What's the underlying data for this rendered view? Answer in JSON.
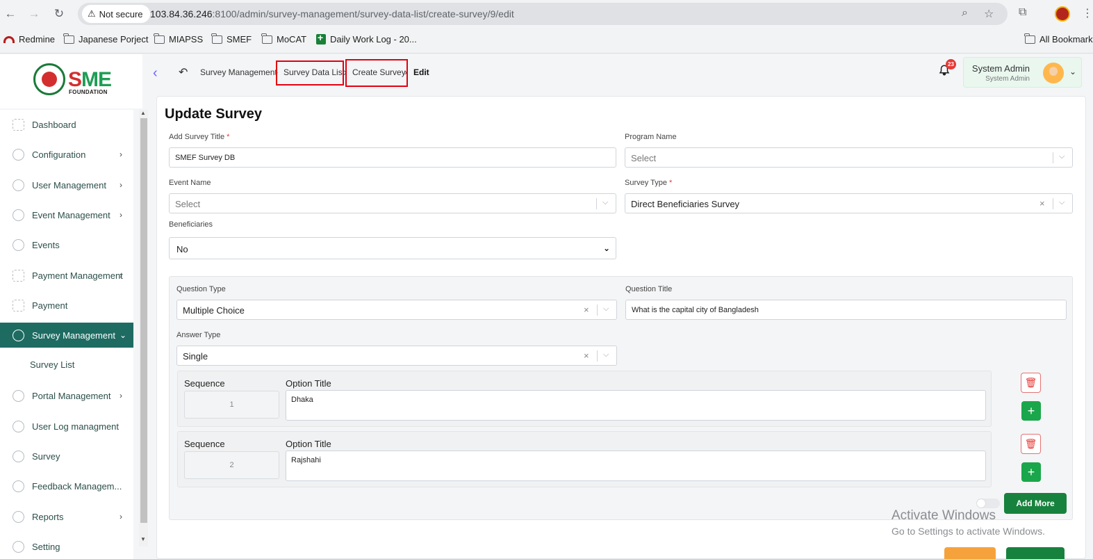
{
  "browser": {
    "security_label": "Not secure",
    "url_host": "103.84.36.246",
    "url_rest": ":8100/admin/survey-management/survey-data-list/create-survey/9/edit",
    "bookmarks": [
      "Redmine",
      "Japanese Porject",
      "MIAPSS",
      "SMEF",
      "MoCAT",
      "Daily Work Log - 20...",
      "All Bookmarks"
    ]
  },
  "logo": {
    "main_s": "S",
    "main_me": "ME",
    "sub": "FOUNDATION"
  },
  "sidebar": {
    "items": [
      {
        "label": "Dashboard",
        "chev": ""
      },
      {
        "label": "Configuration",
        "chev": "›"
      },
      {
        "label": "User Management",
        "chev": "›"
      },
      {
        "label": "Event Management",
        "chev": "›"
      },
      {
        "label": "Events",
        "chev": ""
      },
      {
        "label": "Payment Management",
        "chev": "›"
      },
      {
        "label": "Payment",
        "chev": ""
      },
      {
        "label": "Survey Management",
        "chev": "⌄"
      },
      {
        "label": "Portal Management",
        "chev": "›"
      },
      {
        "label": "User Log managment",
        "chev": ""
      },
      {
        "label": "Survey",
        "chev": ""
      },
      {
        "label": "Feedback Managem...",
        "chev": ""
      },
      {
        "label": "Reports",
        "chev": "›"
      },
      {
        "label": "Setting",
        "chev": ""
      }
    ],
    "sub_item": "Survey List"
  },
  "header": {
    "breadcrumbs": [
      "Survey Management",
      "Survey Data List",
      "Create Survey",
      "Edit"
    ],
    "notification_count": "23",
    "user_name": "System Admin",
    "user_role": "System Admin"
  },
  "form": {
    "title": "Update Survey",
    "survey_title_label": "Add Survey Title",
    "survey_title_value": "SMEF Survey DB",
    "program_label": "Program Name",
    "program_value": "Select",
    "event_label": "Event Name",
    "event_value": "Select",
    "survey_type_label": "Survey Type",
    "survey_type_value": "Direct Beneficiaries Survey",
    "beneficiaries_label": "Beneficiaries",
    "beneficiaries_value": "No",
    "required_mark": "*"
  },
  "question": {
    "type_label": "Question Type",
    "type_value": "Multiple Choice",
    "title_label": "Question Title",
    "title_value": "What is the capital city of Bangladesh",
    "answer_label": "Answer Type",
    "answer_value": "Single",
    "sequence_label": "Sequence",
    "option_label": "Option Title",
    "options": [
      {
        "sequence": "1",
        "title": "Dhaka"
      },
      {
        "sequence": "2",
        "title": "Rajshahi"
      }
    ],
    "add_more_label": "Add More"
  },
  "watermark": {
    "line1": "Activate Windows",
    "line2": "Go to Settings to activate Windows."
  },
  "colors": {
    "accent": "#1e6b62",
    "button_green": "#17823d",
    "highlight_box": "#e3000f"
  }
}
